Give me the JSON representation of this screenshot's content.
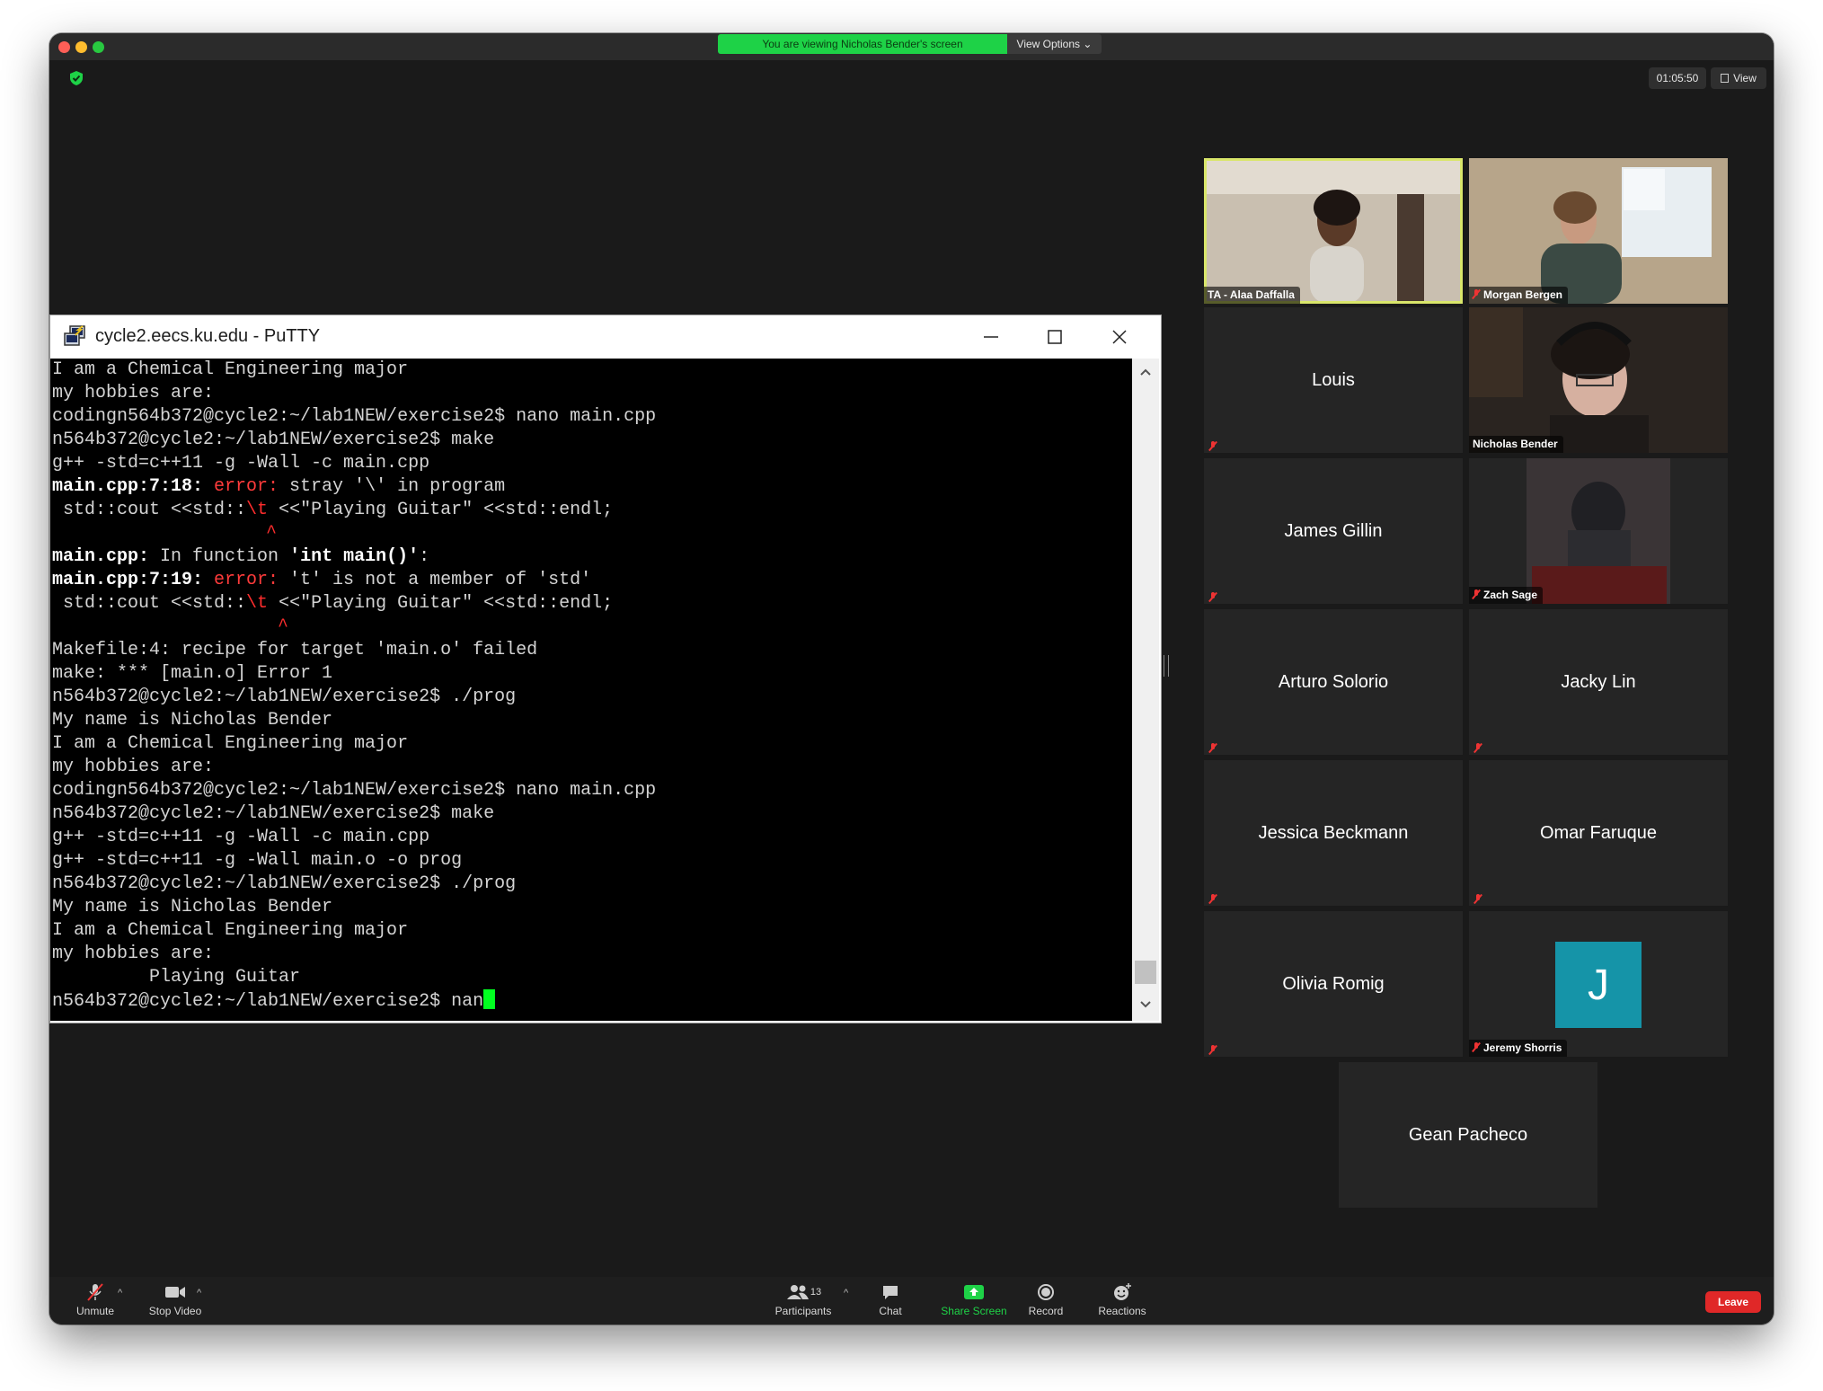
{
  "meeting": {
    "banner": "You are viewing Nicholas Bender's screen",
    "view_options": "View Options",
    "timer": "01:05:50",
    "view_button": "View"
  },
  "putty": {
    "title": "cycle2.eecs.ku.edu - PuTTY"
  },
  "terminal": {
    "lines": [
      "I am a Chemical Engineering major",
      "my hobbies are:",
      "codingn564b372@cycle2:~/lab1NEW/exercise2$ nano main.cpp",
      "n564b372@cycle2:~/lab1NEW/exercise2$ make",
      "g++ -std=c++11 -g -Wall -c main.cpp",
      "main.cpp:7:18: error: stray '\\' in program",
      " std::cout <<std::\\t <<\"Playing Guitar\" <<std::endl;",
      "                  ^",
      "main.cpp: In function 'int main()':",
      "main.cpp:7:19: error: 't' is not a member of 'std'",
      " std::cout <<std::\\t <<\"Playing Guitar\" <<std::endl;",
      "                   ^",
      "Makefile:4: recipe for target 'main.o' failed",
      "make: *** [main.o] Error 1",
      "n564b372@cycle2:~/lab1NEW/exercise2$ ./prog",
      "My name is Nicholas Bender",
      "I am a Chemical Engineering major",
      "my hobbies are:",
      "codingn564b372@cycle2:~/lab1NEW/exercise2$ nano main.cpp",
      "n564b372@cycle2:~/lab1NEW/exercise2$ make",
      "g++ -std=c++11 -g -Wall -c main.cpp",
      "g++ -std=c++11 -g -Wall main.o -o prog",
      "n564b372@cycle2:~/lab1NEW/exercise2$ ./prog",
      "My name is Nicholas Bender",
      "I am a Chemical Engineering major",
      "my hobbies are:",
      "         Playing Guitar",
      "n564b372@cycle2:~/lab1NEW/exercise2$ nan"
    ],
    "err1_prefix": "main.cpp:7:18: ",
    "err1_word": "error:",
    "err1_rest": " stray '\\' in program",
    "err2_prefix": "main.cpp:7:19: ",
    "err2_word": "error:",
    "err2_rest": " 't' is not a member of 'std'",
    "infunc_prefix": "main.cpp:",
    "infunc_mid": " In function ",
    "infunc_fn": "'int main()'",
    "infunc_end": ":",
    "src_a": " std::cout <<std::",
    "src_b": "\\t",
    "src_c": " <<\"Playing Guitar\" <<std::endl;",
    "caret": "^",
    "prompt": "n564b372@cycle2:~/lab1NEW/exercise2$ ",
    "typed": "nan"
  },
  "participants": {
    "alaa": "TA - Alaa Daffalla",
    "morgan": "Morgan Bergen",
    "louis": "Louis",
    "nicholas": "Nicholas Bender",
    "james": "James Gillin",
    "zach": "Zach Sage",
    "arturo": "Arturo Solorio",
    "jacky": "Jacky Lin",
    "jessica": "Jessica Beckmann",
    "omar": "Omar Faruque",
    "olivia": "Olivia Romig",
    "jeremy": "Jeremy Shorris",
    "jeremy_initial": "J",
    "gean": "Gean Pacheco"
  },
  "toolbar": {
    "unmute": "Unmute",
    "stop_video": "Stop Video",
    "participants": "Participants",
    "participants_count": "13",
    "chat": "Chat",
    "share_screen": "Share Screen",
    "record": "Record",
    "reactions": "Reactions",
    "leave": "Leave"
  },
  "colors": {
    "banner": "#1ed247",
    "active_speaker": "#d9e66a",
    "terminal_error": "#ff3b3b",
    "cursor": "#00ff20",
    "leave": "#e02828",
    "avatar_j": "#1594a8"
  }
}
